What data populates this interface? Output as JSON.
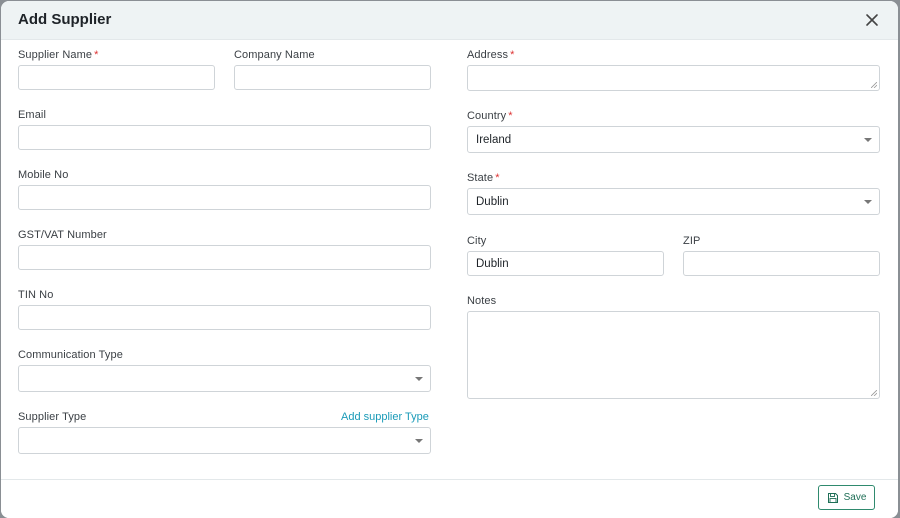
{
  "dialog": {
    "title": "Add Supplier"
  },
  "fields": {
    "supplier_name": {
      "label": "Supplier Name",
      "required": "*",
      "value": ""
    },
    "company_name": {
      "label": "Company Name",
      "value": ""
    },
    "email": {
      "label": "Email",
      "value": ""
    },
    "mobile_no": {
      "label": "Mobile No",
      "value": ""
    },
    "gst_vat": {
      "label": "GST/VAT Number",
      "value": ""
    },
    "tin_no": {
      "label": "TIN No",
      "value": ""
    },
    "communication_type": {
      "label": "Communication Type",
      "value": ""
    },
    "supplier_type": {
      "label": "Supplier Type",
      "value": "",
      "link": "Add supplier Type"
    },
    "address": {
      "label": "Address",
      "required": "*",
      "value": ""
    },
    "country": {
      "label": "Country",
      "required": "*",
      "value": "Ireland"
    },
    "state": {
      "label": "State",
      "required": "*",
      "value": "Dublin"
    },
    "city": {
      "label": "City",
      "value": "Dublin"
    },
    "zip": {
      "label": "ZIP",
      "value": ""
    },
    "notes": {
      "label": "Notes",
      "value": ""
    }
  },
  "footer": {
    "save_label": "Save"
  },
  "icons": {
    "close": "close-icon",
    "save": "floppy-disk-icon",
    "dropdown": "chevron-down-icon"
  },
  "colors": {
    "accent": "#1a9bb8",
    "save": "#2f8a6e",
    "required": "#dd3333"
  }
}
